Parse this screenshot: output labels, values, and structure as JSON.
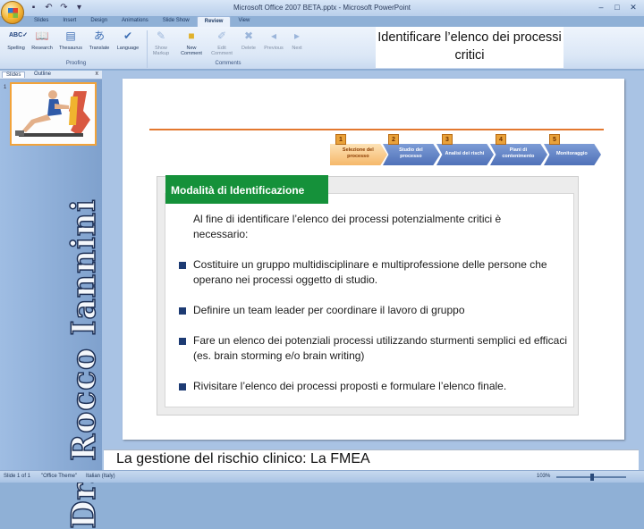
{
  "window": {
    "app_title": "Microsoft Office 2007 BETA.pptx - Microsoft PowerPoint"
  },
  "ribbon": {
    "tabs": [
      "Slides",
      "Insert",
      "Design",
      "Animations",
      "Slide Show",
      "Review",
      "View"
    ],
    "active_tab": "Review",
    "proofing": {
      "label": "Proofing",
      "buttons": [
        "Spelling",
        "Research",
        "Thesaurus",
        "Translate",
        "Language"
      ]
    },
    "comments": {
      "label": "Comments",
      "buttons": [
        "Show Markup",
        "New Comment",
        "Edit Comment",
        "Delete",
        "Previous",
        "Next"
      ]
    }
  },
  "left_pane": {
    "tab_slides": "Slides",
    "tab_outline": "Outline",
    "close": "x",
    "thumb_number": "1",
    "vertical_text": "Dr. Rocco Iannini"
  },
  "overlay_title": "Identificare l’elenco dei processi critici",
  "slide": {
    "steps": [
      {
        "num": "1",
        "label": "Selezione del processo",
        "selected": true
      },
      {
        "num": "2",
        "label": "Studio del processo",
        "selected": false
      },
      {
        "num": "3",
        "label": "Analisi dei rischi",
        "selected": false
      },
      {
        "num": "4",
        "label": "Piani di contenimento",
        "selected": false
      },
      {
        "num": "5",
        "label": "Monitoraggio",
        "selected": false
      }
    ],
    "box_title": "Modalità di Identificazione",
    "intro": "Al fine di identificare l’elenco dei processi potenzialmente critici è necessario:",
    "bullets": [
      "Costituire un gruppo multidisciplinare e multiprofessione  delle persone che operano nei processi oggetto di studio.",
      "Definire un team leader per coordinare il lavoro di gruppo",
      "Fare un elenco dei potenziali processi utilizzando sturmenti semplici ed efficaci (es. brain storming e/o brain writing)",
      "Rivisitare l’elenco dei processi proposti e formulare l’elenco finale."
    ]
  },
  "footer_text": "La gestione del rischio clinico: La FMEA",
  "statusbar": {
    "slide_info": "Slide 1 of 1",
    "theme": "\"Office Theme\"",
    "language": "Italian (Italy)",
    "zoom": "103%"
  },
  "colors": {
    "accent_green": "#15913a",
    "accent_orange": "#e3782f",
    "bullet_navy": "#1d3b73",
    "step_blue": "#5b7fc4"
  }
}
